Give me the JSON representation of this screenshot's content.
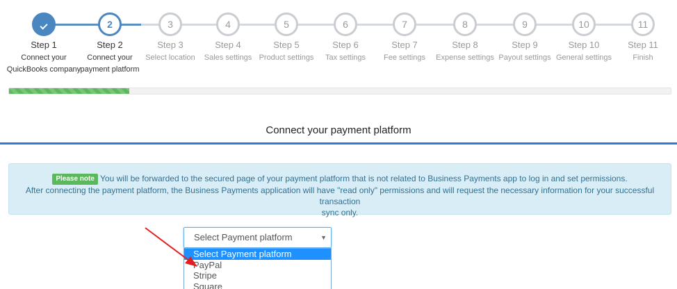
{
  "stepper": {
    "steps": [
      {
        "number": "1",
        "label": "Step 1",
        "desc1": "Connect your",
        "desc2": "QuickBooks company",
        "state": "completed"
      },
      {
        "number": "2",
        "label": "Step 2",
        "desc1": "Connect your",
        "desc2": "payment platform",
        "state": "current"
      },
      {
        "number": "3",
        "label": "Step 3",
        "desc1": "Select location",
        "desc2": "",
        "state": "pending"
      },
      {
        "number": "4",
        "label": "Step 4",
        "desc1": "Sales settings",
        "desc2": "",
        "state": "pending"
      },
      {
        "number": "5",
        "label": "Step 5",
        "desc1": "Product settings",
        "desc2": "",
        "state": "pending"
      },
      {
        "number": "6",
        "label": "Step 6",
        "desc1": "Tax settings",
        "desc2": "",
        "state": "pending"
      },
      {
        "number": "7",
        "label": "Step 7",
        "desc1": "Fee settings",
        "desc2": "",
        "state": "pending"
      },
      {
        "number": "8",
        "label": "Step 8",
        "desc1": "Expense settings",
        "desc2": "",
        "state": "pending"
      },
      {
        "number": "9",
        "label": "Step 9",
        "desc1": "Payout settings",
        "desc2": "",
        "state": "pending"
      },
      {
        "number": "10",
        "label": "Step 10",
        "desc1": "General settings",
        "desc2": "",
        "state": "pending"
      },
      {
        "number": "11",
        "label": "Step 11",
        "desc1": "Finish",
        "desc2": "",
        "state": "pending"
      }
    ]
  },
  "progress": {
    "fraction": 0.182
  },
  "page": {
    "title": "Connect your payment platform"
  },
  "notice": {
    "badge": "Please note",
    "line1": "You will be forwarded to the secured page of your payment platform that is not related to Business Payments app to log in and set permissions.",
    "line2": "After connecting the payment platform, the Business Payments application will have \"read only\" permissions and will request the necessary information for your successful transaction",
    "line3": "sync only."
  },
  "platform_select": {
    "value": "Select Payment platform",
    "options": [
      "Select Payment platform",
      "PayPal",
      "Stripe",
      "Square"
    ]
  },
  "colors": {
    "accent": "#4a86c0",
    "progress": "#5cb85c",
    "info_bg": "#d9edf7",
    "arrow": "#e02020"
  }
}
